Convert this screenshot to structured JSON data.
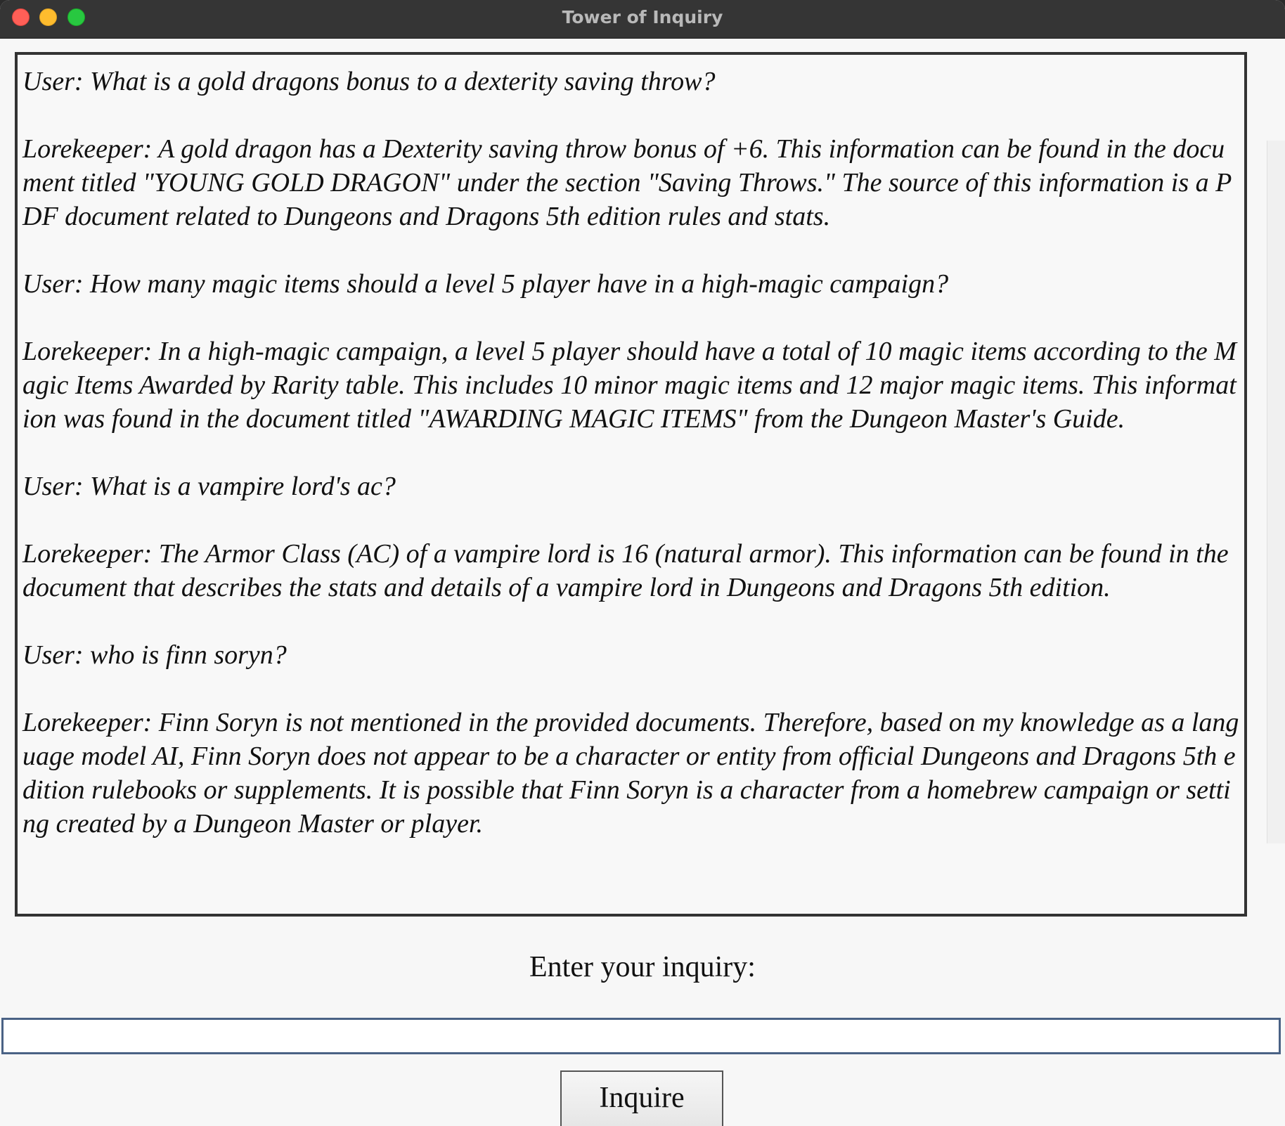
{
  "window": {
    "title": "Tower of Inquiry"
  },
  "transcript": {
    "text": "User: What is a gold dragons bonus to a dexterity saving throw?\n\nLorekeeper: A gold dragon has a Dexterity saving throw bonus of +6. This information can be found in the document titled \"YOUNG GOLD DRAGON\" under the section \"Saving Throws.\" The source of this information is a PDF document related to Dungeons and Dragons 5th edition rules and stats.\n\nUser: How many magic items should a level 5 player have in a high-magic campaign?\n\nLorekeeper: In a high-magic campaign, a level 5 player should have a total of 10 magic items according to the Magic Items Awarded by Rarity table. This includes 10 minor magic items and 12 major magic items. This information was found in the document titled \"AWARDING MAGIC ITEMS\" from the Dungeon Master's Guide.\n\nUser: What is a vampire lord's ac?\n\nLorekeeper: The Armor Class (AC) of a vampire lord is 16 (natural armor). This information can be found in the document that describes the stats and details of a vampire lord in Dungeons and Dragons 5th edition.\n\nUser: who is finn soryn?\n\nLorekeeper: Finn Soryn is not mentioned in the provided documents. Therefore, based on my knowledge as a language model AI, Finn Soryn does not appear to be a character or entity from official Dungeons and Dragons 5th edition rulebooks or supplements. It is possible that Finn Soryn is a character from a homebrew campaign or setting created by a Dungeon Master or player."
  },
  "prompt": {
    "label": "Enter your inquiry:"
  },
  "input": {
    "value": ""
  },
  "button": {
    "label": "Inquire"
  }
}
